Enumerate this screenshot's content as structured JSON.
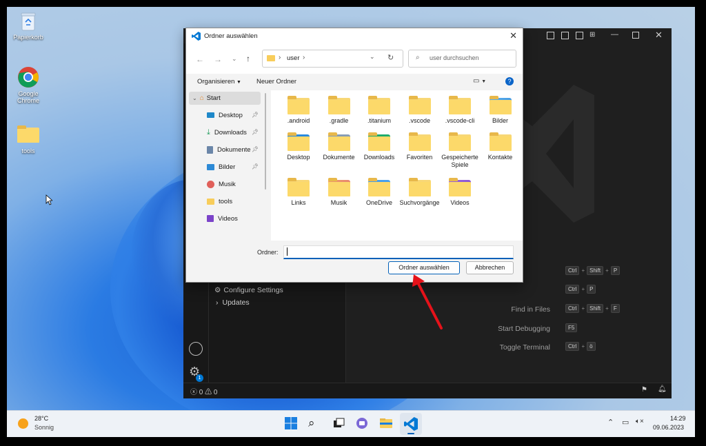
{
  "desktop": {
    "icons": [
      {
        "label": "Papierkorb",
        "icon": "recycle-bin-icon"
      },
      {
        "label": "Google Chrome",
        "icon": "chrome-icon"
      },
      {
        "label": "tools",
        "icon": "folder-icon"
      }
    ]
  },
  "vscode": {
    "sidebar": {
      "items": [
        {
          "label": "Configure Settings",
          "icon": "gear-icon"
        },
        {
          "label": "Updates",
          "icon": "chevron-right-icon"
        }
      ]
    },
    "shortcuts": [
      {
        "label": "",
        "keys": [
          "Ctrl",
          "Shift",
          "P"
        ]
      },
      {
        "label": "",
        "keys": [
          "Ctrl",
          "P"
        ]
      },
      {
        "label": "Find in Files",
        "keys": [
          "Ctrl",
          "Shift",
          "F"
        ]
      },
      {
        "label": "Start Debugging",
        "keys": [
          "F5"
        ]
      },
      {
        "label": "Toggle Terminal",
        "keys": [
          "Ctrl",
          "ö"
        ]
      }
    ],
    "status": {
      "errors": "0",
      "warnings": "0"
    },
    "badge_count": "1"
  },
  "dialog": {
    "title": "Ordner auswählen",
    "address": {
      "path_segment": "user",
      "search_placeholder": "user durchsuchen"
    },
    "toolbar": {
      "organize": "Organisieren",
      "new_folder": "Neuer Ordner"
    },
    "nav": {
      "start": "Start",
      "items": [
        {
          "label": "Desktop",
          "icon": "desktop-icon",
          "pinned": true
        },
        {
          "label": "Downloads",
          "icon": "download-icon",
          "pinned": true
        },
        {
          "label": "Dokumente",
          "icon": "documents-icon",
          "pinned": true
        },
        {
          "label": "Bilder",
          "icon": "pictures-icon",
          "pinned": true
        },
        {
          "label": "Musik",
          "icon": "music-icon",
          "pinned": false
        },
        {
          "label": "tools",
          "icon": "folder-icon",
          "pinned": false
        },
        {
          "label": "Videos",
          "icon": "videos-icon",
          "pinned": false
        }
      ]
    },
    "files": [
      ".android",
      ".gradle",
      ".titanium",
      ".vscode",
      ".vscode-cli",
      "Bilder",
      "Desktop",
      "Dokumente",
      "Downloads",
      "Favoriten",
      "Gespeicherte Spiele",
      "Kontakte",
      "Links",
      "Musik",
      "OneDrive",
      "Suchvorgänge",
      "Videos"
    ],
    "folder_label": "Ordner:",
    "folder_value": "",
    "select_button": "Ordner auswählen",
    "cancel_button": "Abbrechen"
  },
  "taskbar": {
    "weather": {
      "temp": "28°C",
      "condition": "Sonnig"
    },
    "time": "14:29",
    "date": "09.06.2023"
  },
  "colors": {
    "accent": "#005fb8",
    "annotation_arrow": "#e5121a"
  }
}
